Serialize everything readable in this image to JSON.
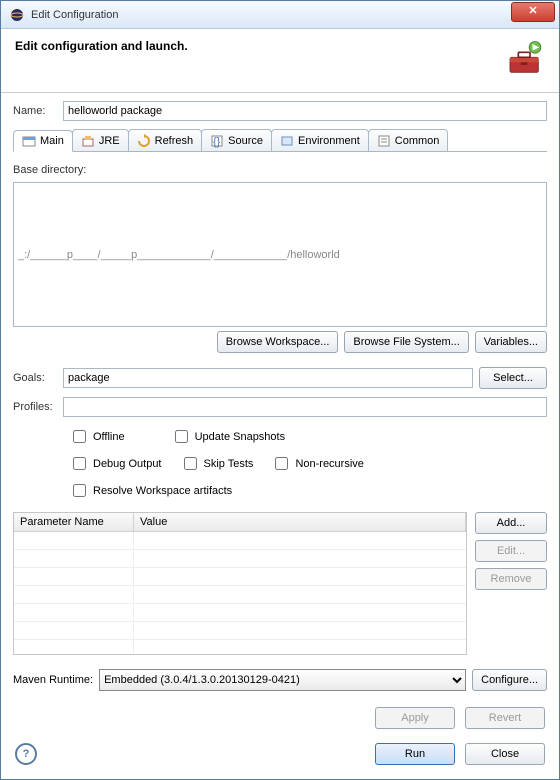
{
  "window": {
    "title": "Edit Configuration"
  },
  "header": {
    "text": "Edit configuration and launch."
  },
  "name": {
    "label": "Name:",
    "value": "helloworld package"
  },
  "tabs": {
    "items": [
      {
        "label": "Main",
        "active": true
      },
      {
        "label": "JRE"
      },
      {
        "label": "Refresh"
      },
      {
        "label": "Source"
      },
      {
        "label": "Environment"
      },
      {
        "label": "Common"
      }
    ]
  },
  "baseDir": {
    "label": "Base directory:",
    "value": "_:/______p____/_____p____________/____________/helloworld",
    "browseWorkspace": "Browse Workspace...",
    "browseFileSystem": "Browse File System...",
    "variables": "Variables..."
  },
  "goals": {
    "label": "Goals:",
    "value": "package",
    "select": "Select..."
  },
  "profiles": {
    "label": "Profiles:",
    "value": ""
  },
  "checks": {
    "offline": "Offline",
    "updateSnapshots": "Update Snapshots",
    "debugOutput": "Debug Output",
    "skipTests": "Skip Tests",
    "nonRecursive": "Non-recursive",
    "resolveWorkspace": "Resolve Workspace artifacts"
  },
  "params": {
    "colName": "Parameter Name",
    "colValue": "Value",
    "add": "Add...",
    "edit": "Edit...",
    "remove": "Remove"
  },
  "runtime": {
    "label": "Maven Runtime:",
    "value": "Embedded (3.0.4/1.3.0.20130129-0421)",
    "configure": "Configure..."
  },
  "footer": {
    "apply": "Apply",
    "revert": "Revert",
    "run": "Run",
    "close": "Close"
  }
}
